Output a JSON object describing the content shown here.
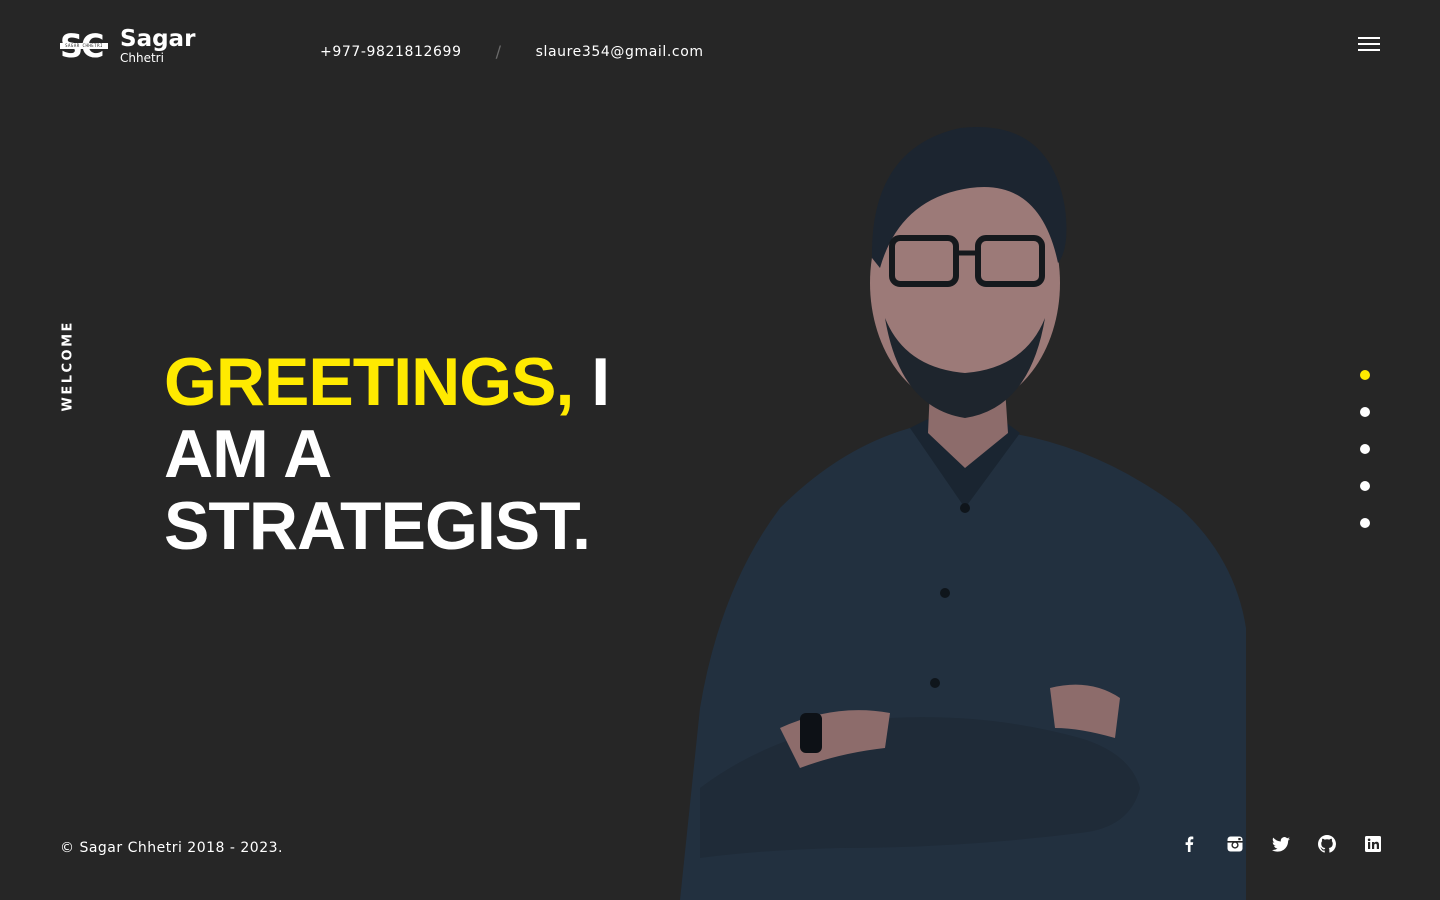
{
  "header": {
    "logo_monogram": "SC",
    "logo_band_text": "SAGAR CHHETRI",
    "logo_first": "Sagar",
    "logo_last": "Chhetri",
    "phone": "+977-9821812699",
    "separator": "/",
    "email": "slaure354@gmail.com",
    "menu_icon": "hamburger-menu-icon"
  },
  "side_label": "WELCOME",
  "hero": {
    "accent_text": "GREETINGS,",
    "rest_line1": " I",
    "line2": "AM A",
    "line3": "STRATEGIST."
  },
  "section_dots": {
    "count": 5,
    "active_index": 0
  },
  "footer": {
    "copyright": "© Sagar Chhetri 2018 - 2023.",
    "social_icons": [
      "facebook-icon",
      "instagram-icon",
      "twitter-icon",
      "github-icon",
      "linkedin-icon"
    ]
  },
  "colors": {
    "background": "#262626",
    "accent": "#ffea00",
    "text": "#ffffff",
    "separator": "#6b6b6b",
    "shirt": "#22303f",
    "skin": "#9c7a78"
  }
}
